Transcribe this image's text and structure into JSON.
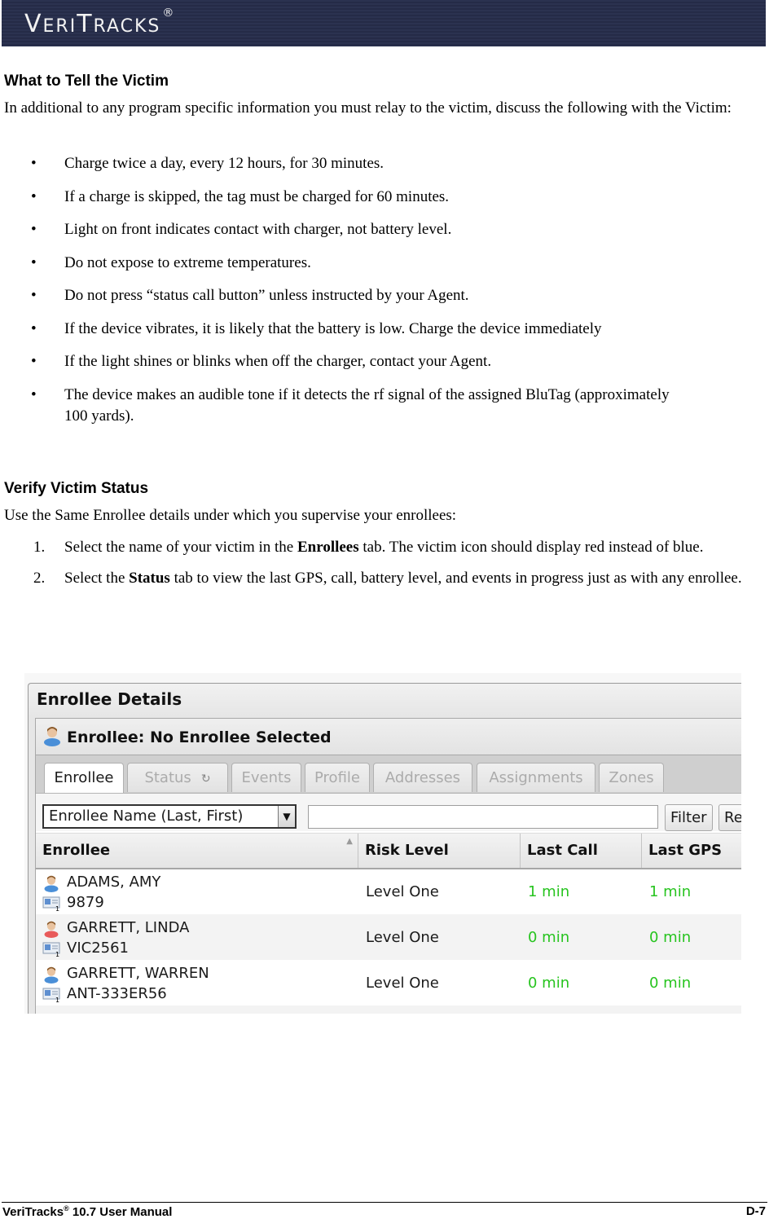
{
  "header": {
    "logo_text_first": "V",
    "logo_text_mid": "ERI",
    "logo_text_t": "T",
    "logo_text_rest": "RACKS",
    "logo_mark": "®"
  },
  "section1": {
    "heading": "What to Tell the Victim",
    "intro": "In additional to any program specific information you must relay to the victim, discuss the following with the Victim:",
    "bullets": [
      "Charge twice a day, every 12 hours, for 30 minutes.",
      "If a charge is skipped, the tag must be charged for 60 minutes.",
      "Light on front indicates contact with charger, not battery level.",
      "Do not expose to extreme temperatures.",
      "Do not press “status call button” unless instructed by your Agent.",
      "If the device vibrates, it is likely that the battery is low. Charge the device immediately",
      "If the light shines or blinks when off the charger, contact your Agent.",
      "The device makes an audible tone if it detects the rf signal of the assigned BluTag (approximately 100 yards)."
    ],
    "bullet_glyph": "•"
  },
  "section2": {
    "heading": "Verify Victim Status",
    "intro": "Use the Same Enrollee details under which you supervise your enrollees:",
    "steps": [
      {
        "num": "1.",
        "pre": "Select the name of your victim in the ",
        "bold": "Enrollees",
        "post": " tab. The victim icon should display red instead of blue."
      },
      {
        "num": "2.",
        "pre": "Select the ",
        "bold": "Status",
        "post": " tab to view the last GPS, call, battery level, and events in progress just as with any enrollee."
      }
    ]
  },
  "screenshot": {
    "panel_title": "Enrollee Details",
    "enrollee_label": "Enrollee:  No Enrollee Selected",
    "tabs": [
      {
        "label": "Enrollee",
        "active": true
      },
      {
        "label": "Status",
        "active": false,
        "icon": "refresh-icon"
      },
      {
        "label": "Events",
        "active": false
      },
      {
        "label": "Profile",
        "active": false
      },
      {
        "label": "Addresses",
        "active": false
      },
      {
        "label": "Assignments",
        "active": false
      },
      {
        "label": "Zones",
        "active": false
      }
    ],
    "filter": {
      "select_value": "Enrollee Name (Last, First)",
      "input_value": "",
      "filter_button": "Filter",
      "reset_button": "Re"
    },
    "columns": [
      "Enrollee",
      "Risk Level",
      "Last Call",
      "Last GPS"
    ],
    "rows": [
      {
        "name": "ADAMS, AMY",
        "id": "9879",
        "risk": "Level One",
        "last_call": "1 min",
        "last_gps": "1 min",
        "icon_color": "blue"
      },
      {
        "name": "GARRETT, LINDA",
        "id": "VIC2561",
        "risk": "Level One",
        "last_call": "0 min",
        "last_gps": "0 min",
        "icon_color": "red"
      },
      {
        "name": "GARRETT, WARREN",
        "id": "ANT-333ER56",
        "risk": "Level One",
        "last_call": "0 min",
        "last_gps": "0 min",
        "icon_color": "blue"
      }
    ],
    "colors": {
      "enrollee_icon": "#4a8fd8",
      "victim_icon": "#e85a5a",
      "status_ok": "#27c41f"
    }
  },
  "footer": {
    "left_prefix": "VeriTracks",
    "left_mark": "®",
    "left_suffix": " 10.7 User Manual",
    "page": "D-7"
  }
}
